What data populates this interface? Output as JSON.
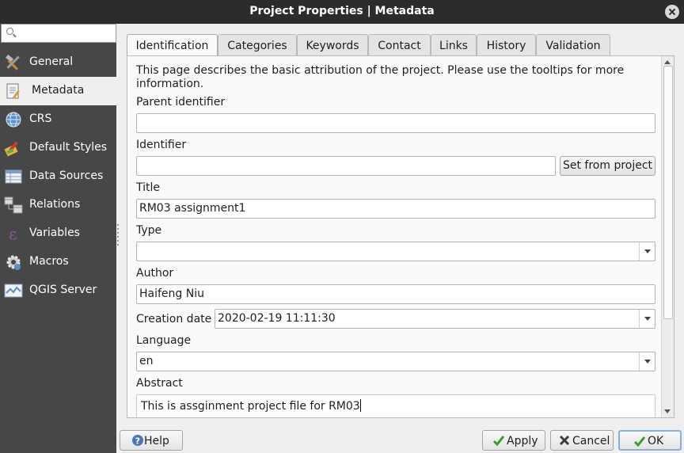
{
  "window": {
    "title": "Project Properties | Metadata"
  },
  "sidebar": {
    "search_placeholder": "",
    "items": [
      {
        "label": "General",
        "icon": "hammer-wrench-icon"
      },
      {
        "label": "Metadata",
        "icon": "metadata-document-icon",
        "selected": true
      },
      {
        "label": "CRS",
        "icon": "globe-icon"
      },
      {
        "label": "Default Styles",
        "icon": "paint-brush-icon"
      },
      {
        "label": "Data Sources",
        "icon": "data-table-icon"
      },
      {
        "label": "Relations",
        "icon": "relations-table-icon"
      },
      {
        "label": "Variables",
        "icon": "epsilon-icon"
      },
      {
        "label": "Macros",
        "icon": "gear-script-icon"
      },
      {
        "label": "QGIS Server",
        "icon": "server-map-icon"
      }
    ]
  },
  "tabs": [
    "Identification",
    "Categories",
    "Keywords",
    "Contact",
    "Links",
    "History",
    "Validation"
  ],
  "active_tab": "Identification",
  "page": {
    "description": "This page describes the basic attribution of the project. Please use the tooltips for more information.",
    "parent_identifier_label": "Parent identifier",
    "parent_identifier_value": "",
    "identifier_label": "Identifier",
    "identifier_value": "",
    "set_from_project_label": "Set from project",
    "title_label": "Title",
    "title_value": "RM03 assignment1",
    "type_label": "Type",
    "type_value": "",
    "author_label": "Author",
    "author_value": "Haifeng Niu",
    "creation_date_label": "Creation date",
    "creation_date_value": "2020-02-19 11:11:30",
    "language_label": "Language",
    "language_value": "en",
    "abstract_label": "Abstract",
    "abstract_value": "This is assginment project file for RM03"
  },
  "buttons": {
    "help": "Help",
    "apply": "Apply",
    "cancel": "Cancel",
    "ok": "OK"
  },
  "colors": {
    "titlebar": "#2c2c2c",
    "sidebar": "#474747",
    "dialog_bg": "#efefef",
    "ok_focus": "#8ab0d8",
    "check_green": "#3a9b2a"
  }
}
